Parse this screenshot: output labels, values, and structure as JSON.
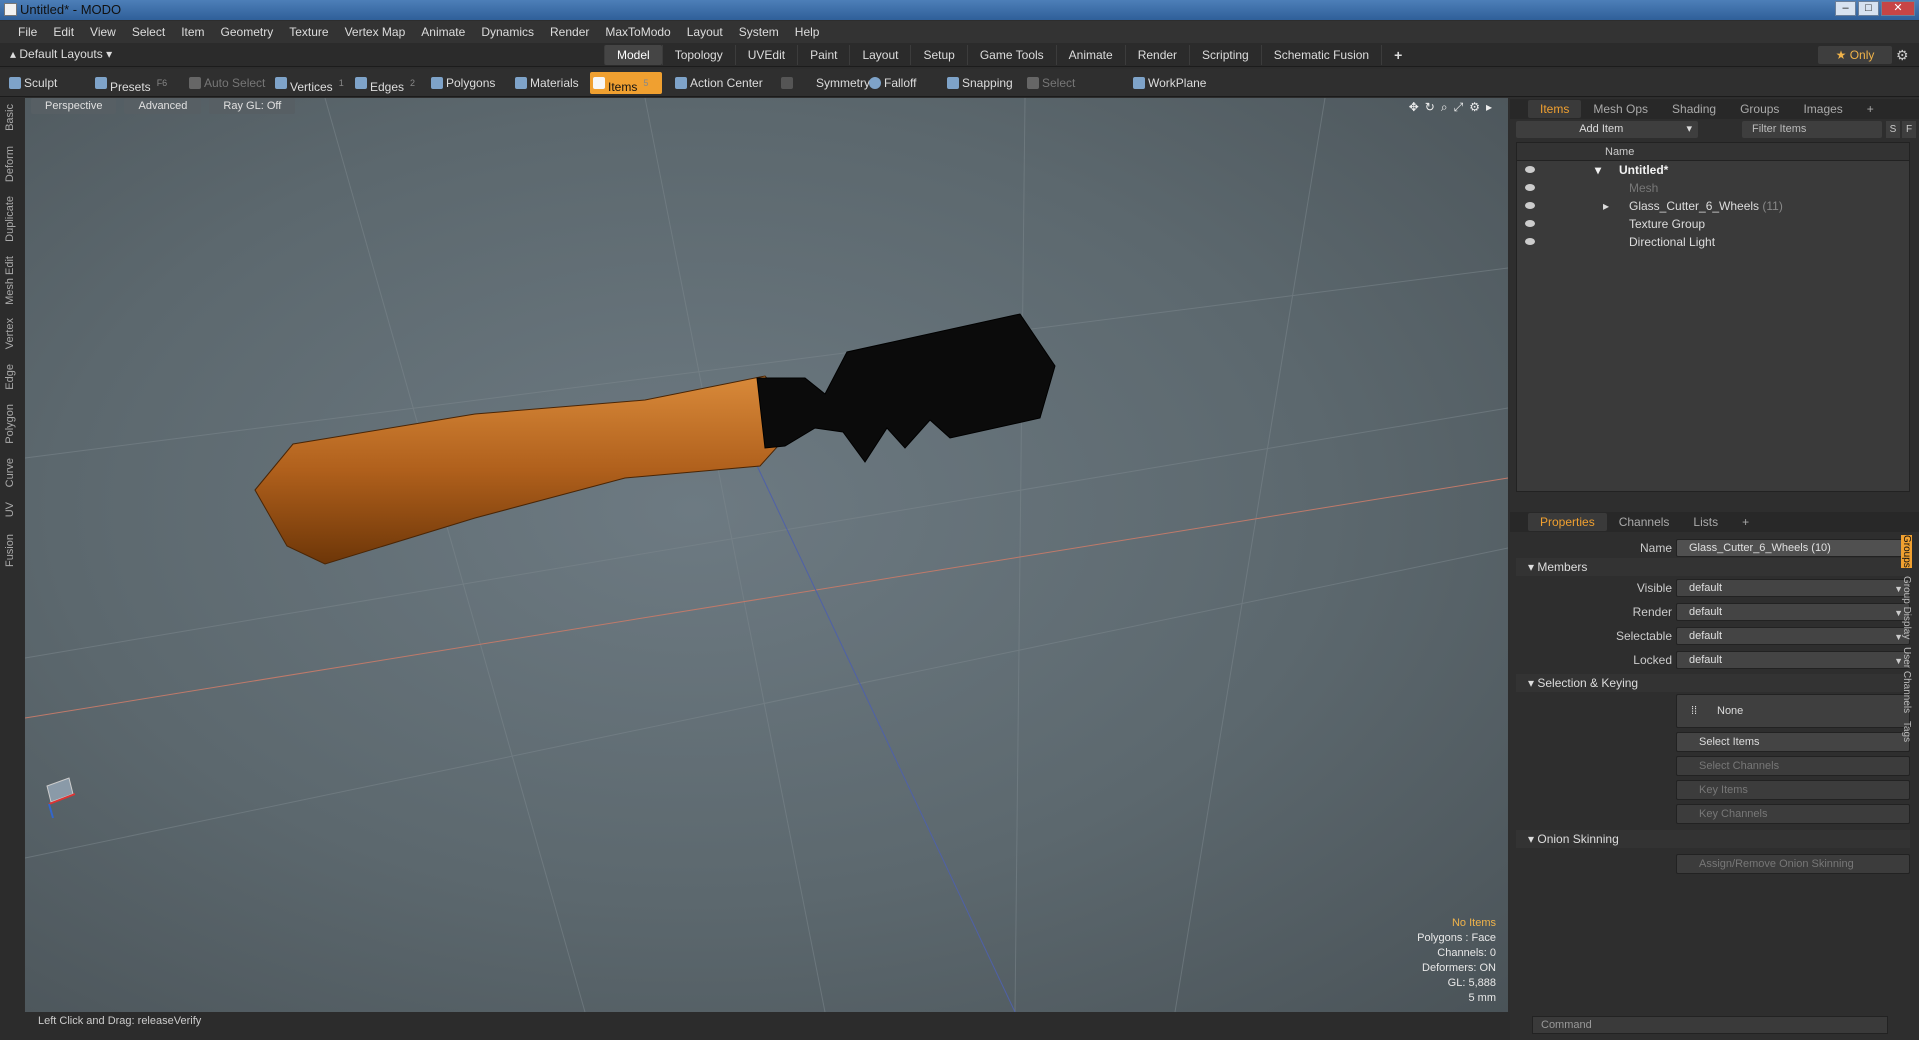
{
  "window": {
    "title": "Untitled* - MODO"
  },
  "menubar": [
    "File",
    "Edit",
    "View",
    "Select",
    "Item",
    "Geometry",
    "Texture",
    "Vertex Map",
    "Animate",
    "Dynamics",
    "Render",
    "MaxToModo",
    "Layout",
    "System",
    "Help"
  ],
  "layout_selector": "Default Layouts",
  "mode_tabs": [
    "Model",
    "Topology",
    "UVEdit",
    "Paint",
    "Layout",
    "Setup",
    "Game Tools",
    "Animate",
    "Render",
    "Scripting",
    "Schematic Fusion",
    "+"
  ],
  "active_mode": "Model",
  "only_label": "Only",
  "toolbar": {
    "sculpt": "Sculpt",
    "presets": "Presets",
    "presets_key": "F6",
    "auto_select": "Auto Select",
    "vertices": "Vertices",
    "vertices_key": "1",
    "edges": "Edges",
    "edges_key": "2",
    "polygons": "Polygons",
    "materials": "Materials",
    "items": "Items",
    "items_key": "5",
    "action_center": "Action Center",
    "symmetry": "Symmetry",
    "falloff": "Falloff",
    "snapping": "Snapping",
    "select_through": "Select Through",
    "workplane": "WorkPlane"
  },
  "left_tabs": [
    "Basic",
    "Deform",
    "Duplicate",
    "Mesh Edit",
    "Vertex",
    "Edge",
    "Polygon",
    "Curve",
    "UV",
    "Fusion"
  ],
  "viewport": {
    "view": "Perspective",
    "shading": "Advanced",
    "raygl": "Ray GL: Off",
    "info": {
      "no_items": "No Items",
      "polygons": "Polygons : Face",
      "channels": "Channels: 0",
      "deformers": "Deformers: ON",
      "gl": "GL: 5,888",
      "unit": "5 mm"
    }
  },
  "status": {
    "hint": "Left Click and Drag:  releaseVerify"
  },
  "items_panel": {
    "tabs": [
      "Items",
      "Mesh Ops",
      "Shading",
      "Groups",
      "Images",
      "+"
    ],
    "add_item": "Add Item",
    "filter": "Filter Items",
    "s_btn": "S",
    "f_btn": "F",
    "column_name": "Name",
    "tree": [
      {
        "label": "Untitled*",
        "meta": ""
      },
      {
        "label": "Mesh",
        "meta": ""
      },
      {
        "label": "Glass_Cutter_6_Wheels",
        "meta": "(11)"
      },
      {
        "label": "Texture Group",
        "meta": ""
      },
      {
        "label": "Directional Light",
        "meta": ""
      }
    ]
  },
  "properties_panel": {
    "tabs": [
      "Properties",
      "Channels",
      "Lists",
      "+"
    ],
    "name_label": "Name",
    "name_value": "Glass_Cutter_6_Wheels (10)",
    "members_section": "Members",
    "visible_label": "Visible",
    "visible_value": "default",
    "render_label": "Render",
    "render_value": "default",
    "selectable_label": "Selectable",
    "selectable_value": "default",
    "locked_label": "Locked",
    "locked_value": "default",
    "selection_section": "Selection & Keying",
    "none_label": "None",
    "select_items": "Select Items",
    "select_channels": "Select Channels",
    "key_items": "Key Items",
    "key_channels": "Key Channels",
    "onion_section": "Onion Skinning",
    "onion_btn": "Assign/Remove Onion Skinning",
    "side_tabs": [
      "Groups",
      "Group Display",
      "User Channels",
      "Tags"
    ]
  },
  "command": {
    "placeholder": "Command"
  },
  "colors": {
    "accent": "#f0a030",
    "viewport": "#5f6b71",
    "handle": "#b56a1f"
  }
}
